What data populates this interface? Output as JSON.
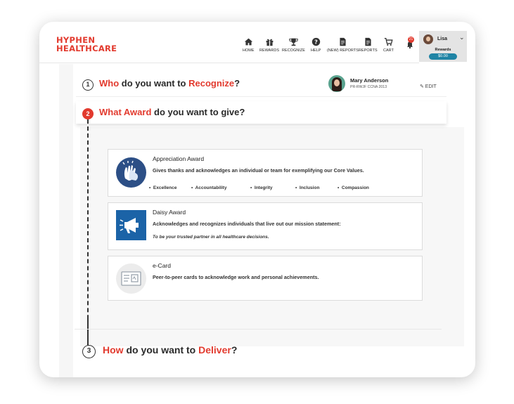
{
  "brand": {
    "line1": "HYPHEN",
    "line2": "HEALTHCARE",
    "color": "#e23a2e"
  },
  "nav": [
    {
      "label": "HOME",
      "icon": "home-icon"
    },
    {
      "label": "REWARDS",
      "icon": "gift-icon"
    },
    {
      "label": "RECOGNIZE",
      "icon": "trophy-icon"
    },
    {
      "label": "HELP",
      "icon": "help-icon"
    },
    {
      "label": "(NEW) REPORTS",
      "icon": "document-icon"
    },
    {
      "label": "REPORTS",
      "icon": "document-icon"
    },
    {
      "label": "CART",
      "icon": "cart-icon"
    }
  ],
  "notifications": {
    "count": "21"
  },
  "user": {
    "name": "Lisa",
    "rewards_label": "Rewards",
    "rewards_balance": "$0.00"
  },
  "steps": {
    "s1": {
      "number": "1",
      "pre": "Who",
      "mid": " do you want to ",
      "hl": "Recognize",
      "post": "?"
    },
    "s2": {
      "number": "2",
      "pre": "What Award",
      "mid": " do you want to give?"
    },
    "s3": {
      "number": "3",
      "pre": "How",
      "mid": " do you want to ",
      "hl": "Deliver",
      "post": "?"
    }
  },
  "recipient": {
    "name": "Mary Anderson",
    "subtitle": "PR-RWJF CCNA 2013",
    "edit_label": "✎ EDIT"
  },
  "awards": [
    {
      "title": "Appreciation Award",
      "description": "Gives thanks and acknowledges an individual or team for exemplifying our Core Values.",
      "values": [
        "Excellence",
        "Accountability",
        "Integrity",
        "Inclusion",
        "Compassion"
      ]
    },
    {
      "title": "Daisy Award",
      "description": "Acknowledges and recognizes individuals that live out our mission statement:",
      "mission": "To be your trusted partner in all healthcare decisions."
    },
    {
      "title": "e-Card",
      "description": "Peer-to-peer cards to acknowledge work and personal achievements."
    }
  ],
  "colors": {
    "accent": "#e23a2e",
    "rewards_pill": "#1f84a5",
    "award_blue": "#2c4f86"
  }
}
